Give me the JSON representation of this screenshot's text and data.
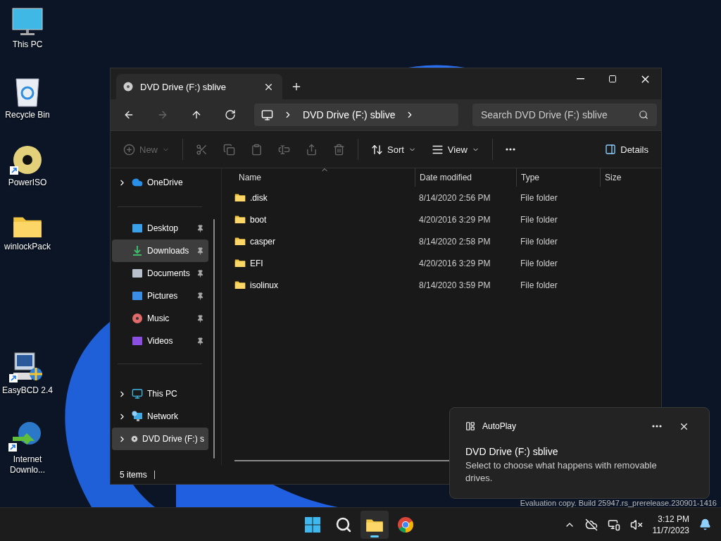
{
  "desktop_icons": [
    {
      "kind": "monitor",
      "label": "This PC",
      "shortcut": false
    },
    {
      "kind": "recycle",
      "label": "Recycle Bin",
      "shortcut": false
    },
    {
      "kind": "disc",
      "label": "PowerISO",
      "shortcut": true
    },
    {
      "kind": "folder",
      "label": "winlockPack",
      "shortcut": false
    },
    {
      "kind": "app",
      "label": "EasyBCD 2.4",
      "shortcut": true
    },
    {
      "kind": "globe",
      "label": "Internet Downlo...",
      "shortcut": true
    }
  ],
  "window": {
    "tab": {
      "title": "DVD Drive (F:) sblive",
      "selected": true
    },
    "nav": [
      {
        "kind": "back",
        "disabled": false
      },
      {
        "kind": "forward",
        "disabled": true
      },
      {
        "kind": "up",
        "disabled": false
      },
      {
        "kind": "refresh",
        "disabled": false
      }
    ],
    "breadcrumb": [
      "DVD Drive (F:) sblive"
    ],
    "search": {
      "placeholder": "Search DVD Drive (F:) sblive"
    },
    "commands": [
      {
        "kind": "new",
        "label": "New",
        "disabled": true
      },
      {
        "kind": "cut",
        "disabled": true
      },
      {
        "kind": "copy",
        "disabled": true
      },
      {
        "kind": "paste",
        "disabled": true
      },
      {
        "kind": "rename",
        "disabled": true
      },
      {
        "kind": "share",
        "disabled": true
      },
      {
        "kind": "delete",
        "disabled": true
      },
      {
        "kind": "sort",
        "label": "Sort",
        "disabled": false
      },
      {
        "kind": "view",
        "label": "View",
        "disabled": false
      },
      {
        "kind": "more",
        "disabled": false
      }
    ],
    "details_button": "Details",
    "sidebar": {
      "sections": [
        {
          "items": [
            {
              "kind": "onedrive",
              "label": "OneDrive",
              "expandable": true,
              "pinned": false,
              "selected": false
            }
          ]
        },
        {
          "items": [
            {
              "kind": "desktop",
              "label": "Desktop",
              "expandable": false,
              "pinned": true,
              "selected": false
            },
            {
              "kind": "downloads",
              "label": "Downloads",
              "expandable": false,
              "pinned": true,
              "selected": true
            },
            {
              "kind": "documents",
              "label": "Documents",
              "expandable": false,
              "pinned": true,
              "selected": false
            },
            {
              "kind": "pictures",
              "label": "Pictures",
              "expandable": false,
              "pinned": true,
              "selected": false
            },
            {
              "kind": "music",
              "label": "Music",
              "expandable": false,
              "pinned": true,
              "selected": false
            },
            {
              "kind": "videos",
              "label": "Videos",
              "expandable": false,
              "pinned": true,
              "selected": false
            }
          ]
        },
        {
          "items": [
            {
              "kind": "thispc",
              "label": "This PC",
              "expandable": true,
              "pinned": false,
              "selected": false
            },
            {
              "kind": "network",
              "label": "Network",
              "expandable": true,
              "pinned": false,
              "selected": false
            },
            {
              "kind": "dvd",
              "label": "DVD Drive (F:) s",
              "expandable": true,
              "pinned": false,
              "selected": true
            }
          ]
        }
      ]
    },
    "columns": [
      "Name",
      "Date modified",
      "Type",
      "Size"
    ],
    "rows": [
      {
        "name": ".disk",
        "date": "8/14/2020 2:56 PM",
        "type": "File folder"
      },
      {
        "name": "boot",
        "date": "4/20/2016 3:29 PM",
        "type": "File folder"
      },
      {
        "name": "casper",
        "date": "8/14/2020 2:58 PM",
        "type": "File folder"
      },
      {
        "name": "EFI",
        "date": "4/20/2016 3:29 PM",
        "type": "File folder"
      },
      {
        "name": "isolinux",
        "date": "8/14/2020 3:59 PM",
        "type": "File folder"
      }
    ],
    "status_bar": "5 items"
  },
  "watermark": "Evaluation copy. Build 25947.rs_prerelease.230901-1416",
  "toast": {
    "app": "AutoPlay",
    "title": "DVD Drive (F:) sblive",
    "body": "Select to choose what happens with removable drives."
  },
  "taskbar": {
    "apps": [
      {
        "kind": "start",
        "active": false
      },
      {
        "kind": "search",
        "active": false
      },
      {
        "kind": "explorer",
        "active": true
      },
      {
        "kind": "chrome",
        "active": false
      }
    ],
    "time": "3:12 PM",
    "date": "11/7/2023"
  }
}
